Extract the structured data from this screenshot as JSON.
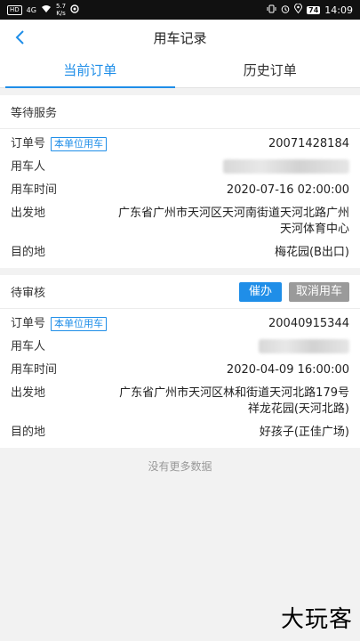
{
  "status": {
    "network": "HD",
    "signal": "4G",
    "speed_top": "5.7",
    "speed_bottom": "K/s",
    "battery": "74",
    "time": "14:09"
  },
  "nav": {
    "title": "用车记录"
  },
  "tabs": [
    {
      "label": "当前订单",
      "active": true
    },
    {
      "label": "历史订单",
      "active": false
    }
  ],
  "labels": {
    "order_no": "订单号",
    "user": "用车人",
    "time": "用车时间",
    "origin": "出发地",
    "dest": "目的地"
  },
  "orders": [
    {
      "status": "等待服务",
      "tag": "本单位用车",
      "order_no": "20071428184",
      "time": "2020-07-16 02:00:00",
      "origin": "广东省广州市天河区天河南街道天河北路广州天河体育中心",
      "dest": "梅花园(B出口)"
    },
    {
      "status": "待审核",
      "tag": "本单位用车",
      "order_no": "20040915344",
      "time": "2020-04-09 16:00:00",
      "origin": "广东省广州市天河区林和街道天河北路179号祥龙花园(天河北路)",
      "dest": "好孩子(正佳广场)",
      "btn_urge": "催办",
      "btn_cancel": "取消用车"
    }
  ],
  "footer": {
    "no_more": "没有更多数据"
  },
  "watermark": "大玩客",
  "colors": {
    "accent": "#1f8ee8",
    "gray_button": "#9a9a9a",
    "background": "#f2f2f2"
  }
}
